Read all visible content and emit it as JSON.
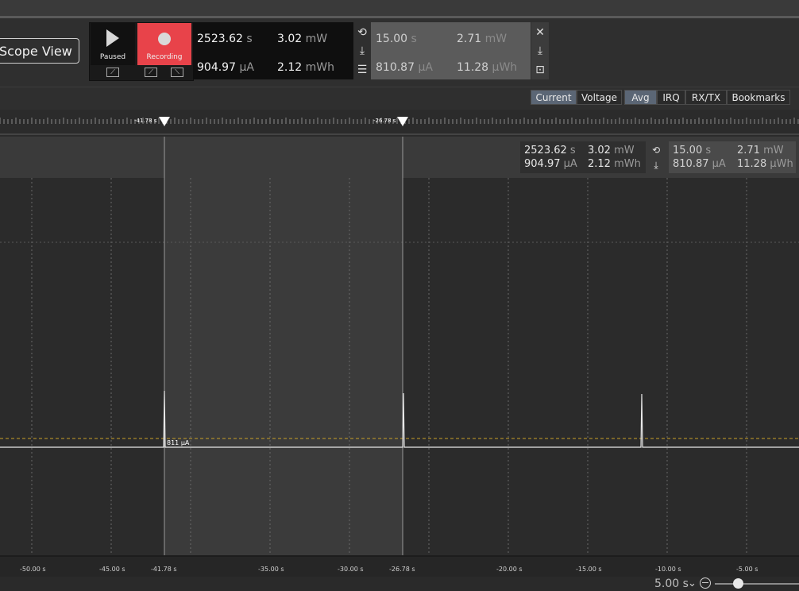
{
  "toolbar": {
    "scope_view_label": "Scope View",
    "paused_label": "Paused",
    "recording_label": "Recording",
    "time_value": "2523.62",
    "time_unit": "s",
    "current_value": "904.97",
    "current_unit": "µA",
    "power_value": "3.02",
    "power_unit": "mW",
    "energy_value": "2.12",
    "energy_unit": "mWh",
    "sel_time_value": "15.00",
    "sel_time_unit": "s",
    "sel_current_value": "810.87",
    "sel_current_unit": "µA",
    "sel_power_value": "2.71",
    "sel_power_unit": "mW",
    "sel_energy_value": "11.28",
    "sel_energy_unit": "µWh"
  },
  "tabs": [
    "Current",
    "Voltage",
    "Avg",
    "IRQ",
    "RX/TX",
    "Bookmarks"
  ],
  "markers": {
    "left_label": "-41.78 s",
    "right_label": "-26.78 s"
  },
  "overlay": {
    "time_value": "2523.62",
    "time_unit": "s",
    "current_value": "904.97",
    "current_unit": "µA",
    "power_value": "3.02",
    "power_unit": "mW",
    "energy_value": "2.12",
    "energy_unit": "mWh",
    "sel_time_value": "15.00",
    "sel_time_unit": "s",
    "sel_current_value": "810.87",
    "sel_current_unit": "µA",
    "sel_power_value": "2.71",
    "sel_power_unit": "mW",
    "sel_energy_value": "11.28",
    "sel_energy_unit": "µWh"
  },
  "plot": {
    "level_label": "811 µA",
    "colors": {
      "trace": "#e8e8e8",
      "avg_line": "#c9a227",
      "selection": "#3a3a3a",
      "background": "#2b2b2b"
    }
  },
  "xaxis": {
    "ticks": [
      "-50.00 s",
      "-45.00 s",
      "-41.78 s",
      "-35.00 s",
      "-30.00 s",
      "-26.78 s",
      "-20.00 s",
      "-15.00 s",
      "-10.00 s",
      "-5.00 s"
    ]
  },
  "zoom": {
    "value": "5.00 s"
  }
}
